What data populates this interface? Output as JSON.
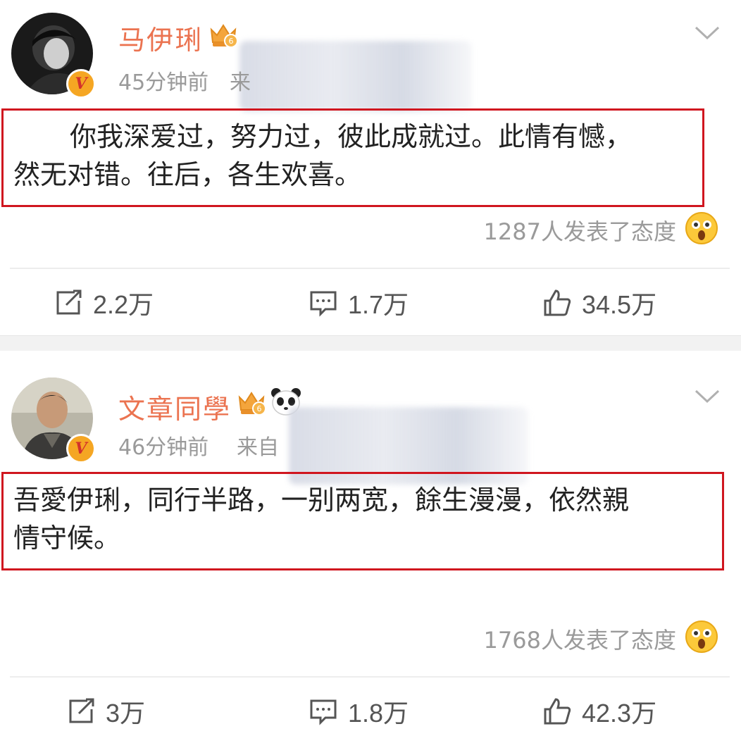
{
  "posts": [
    {
      "username": "马伊琍",
      "time": "45分钟前",
      "source": "来",
      "content_line1": "你我深爱过，努力过，彼此成就过。此情有憾，",
      "content_line2": "然无对错。往后，各生欢喜。",
      "attitude": "1287人发表了态度",
      "actions": {
        "repost": "2.2万",
        "comment": "1.7万",
        "like": "34.5万"
      }
    },
    {
      "username": "文章同學",
      "time": "46分钟前",
      "source": "来自",
      "content_line1": "吾愛伊琍，同行半路，一别两宽，餘生漫漫，依然親",
      "content_line2": "情守候。",
      "attitude": "1768人发表了态度",
      "actions": {
        "repost": "3万",
        "comment": "1.8万",
        "like": "42.3万"
      }
    }
  ],
  "icons": {
    "verified": "verified-badge-icon",
    "crown": "crown-level-icon",
    "panda": "panda-badge-icon",
    "chevron": "chevron-down-icon",
    "attitude_emoji": "surprised-emoji-icon",
    "repost": "repost-icon",
    "comment": "comment-icon",
    "like": "thumbs-up-icon"
  },
  "colors": {
    "username": "#eb7350",
    "highlight_border": "#d0161f",
    "verified_badge": "#f5a623",
    "muted_text": "#9a9a9a"
  }
}
